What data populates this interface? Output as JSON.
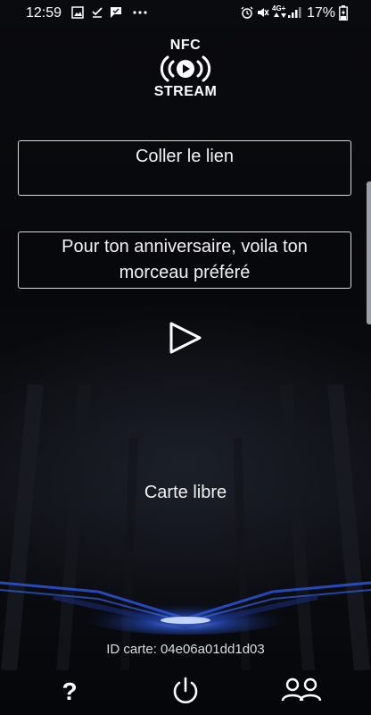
{
  "status_bar": {
    "time": "12:59",
    "network": "4G+",
    "battery_percent": "17%"
  },
  "logo": {
    "line_top": "NFC",
    "line_bottom": "STREAM"
  },
  "form": {
    "link_placeholder": "Coller le lien",
    "message_line_1": "Pour ton anniversaire, voila ton",
    "message_line_2": "morceau préféré"
  },
  "card": {
    "status": "Carte libre",
    "id_label": "ID carte:",
    "id_value": "04e06a01dd1d03"
  },
  "bottom_bar": {
    "help_label": "?"
  },
  "colors": {
    "background": "#050608",
    "accent_glow": "#3a6cff",
    "text": "#ffffff"
  }
}
